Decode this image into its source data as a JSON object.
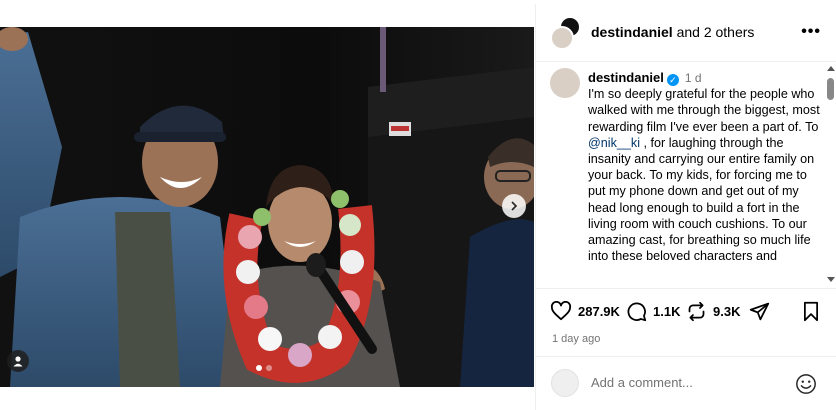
{
  "header": {
    "username": "destindaniel",
    "others_text": " and 2 others",
    "more_label": "•••"
  },
  "caption": {
    "username": "destindaniel",
    "verified_mark": "✓",
    "time": "1 d",
    "text_part1": "I'm so deeply grateful for the people who walked with me through the biggest, most rewarding film I've ever been a part of. To ",
    "mention": "@nik__ki",
    "text_part2": " , for laughing through the insanity and carrying our entire family on your back. To my kids, for forcing me to put my phone down and get out of my head long enough to build a fort in the living room with couch cushions. To our amazing cast, for breathing so much life into these beloved characters and"
  },
  "actions": {
    "likes": "287.9K",
    "comments": "1.1K",
    "reposts": "9.3K",
    "icons": [
      "heart-icon",
      "comment-icon",
      "repost-icon",
      "share-icon",
      "bookmark-icon"
    ]
  },
  "date": "1 day ago",
  "comment_box": {
    "placeholder": "Add a comment...",
    "value": ""
  },
  "carousel": {
    "total_slides": 2,
    "active_slide": 1
  },
  "colors": {
    "accent_blue": "#0095f6",
    "mention_color": "#00376b",
    "muted_text": "#737373"
  }
}
